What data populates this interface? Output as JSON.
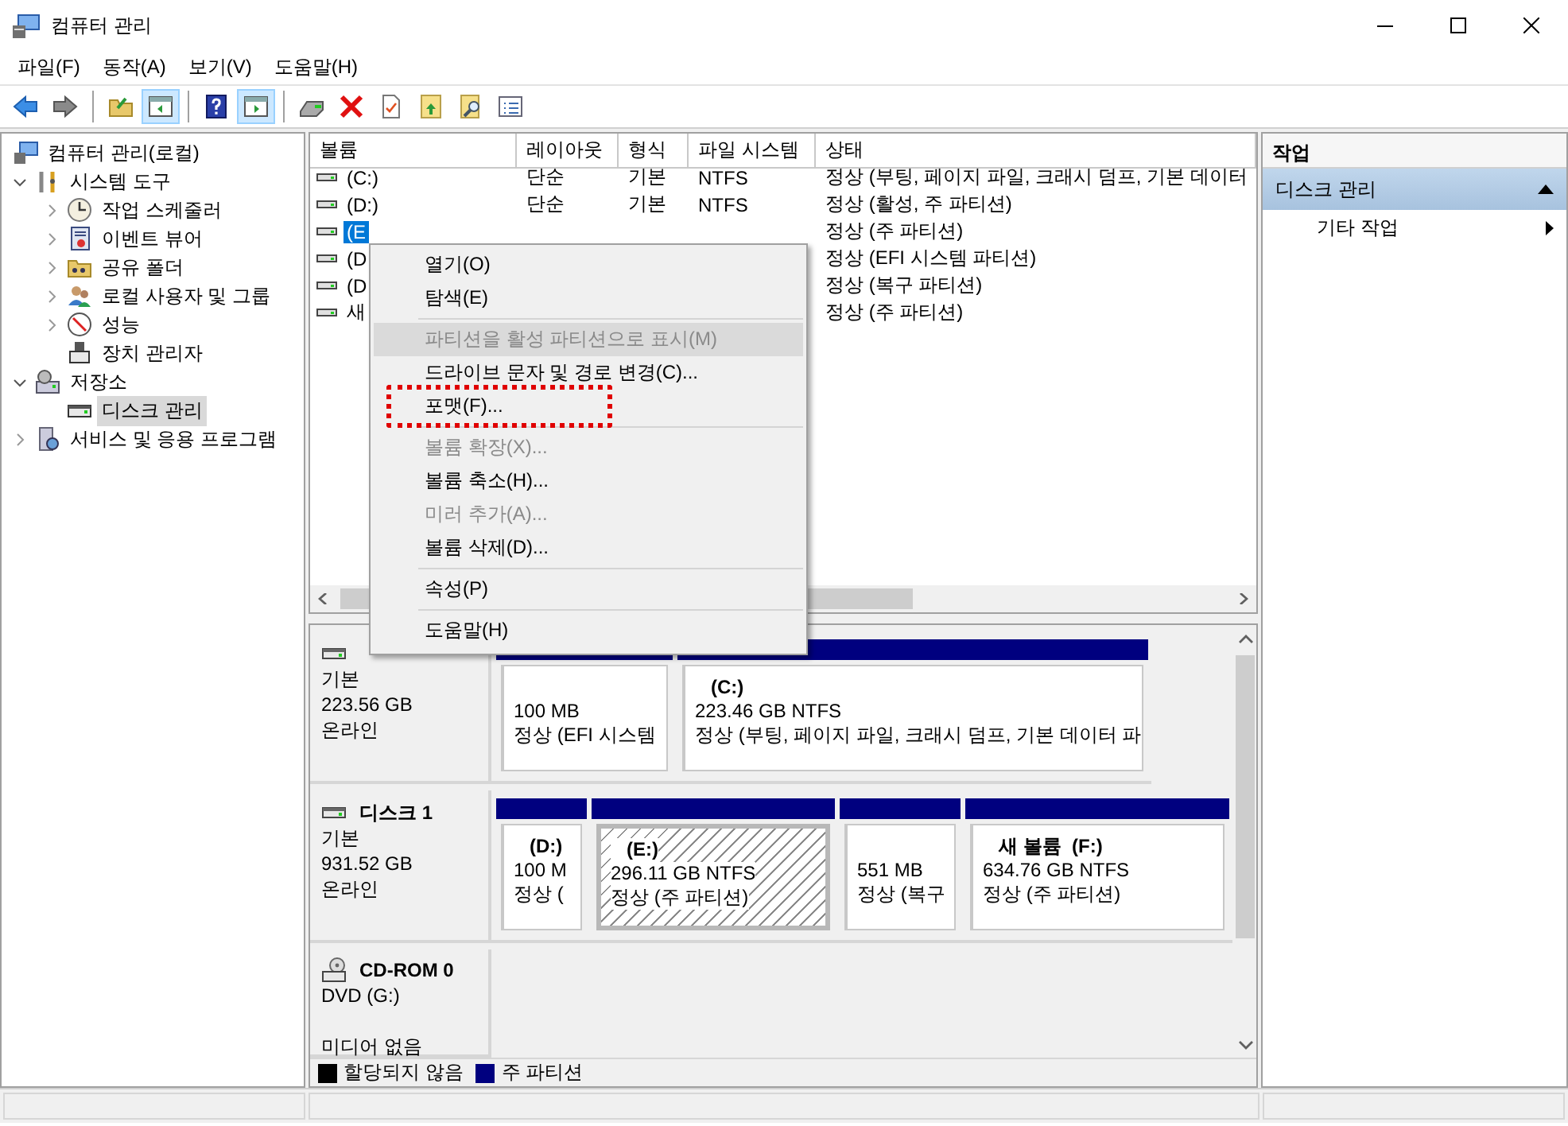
{
  "window": {
    "title": "컴퓨터 관리"
  },
  "menu_bar": [
    "파일(F)",
    "동작(A)",
    "보기(V)",
    "도움말(H)"
  ],
  "toolbar": [
    {
      "kind": "button",
      "pressed": false
    },
    {
      "kind": "button",
      "pressed": false
    },
    {
      "kind": "separator"
    },
    {
      "kind": "button",
      "pressed": false
    },
    {
      "kind": "button",
      "pressed": true
    },
    {
      "kind": "separator"
    },
    {
      "kind": "button",
      "pressed": false
    },
    {
      "kind": "button",
      "pressed": true
    },
    {
      "kind": "separator"
    },
    {
      "kind": "button",
      "pressed": false
    },
    {
      "kind": "button",
      "pressed": false
    },
    {
      "kind": "button",
      "pressed": false
    },
    {
      "kind": "button",
      "pressed": false
    },
    {
      "kind": "button",
      "pressed": false
    },
    {
      "kind": "button",
      "pressed": false
    }
  ],
  "tree": [
    {
      "label": "컴퓨터 관리(로컬)",
      "selected": false,
      "children": [
        {
          "label": "시스템 도구",
          "expanded": true,
          "selected": false,
          "children": [
            {
              "label": "작업 스케줄러",
              "expanded": false,
              "selected": false
            },
            {
              "label": "이벤트 뷰어",
              "expanded": false,
              "selected": false
            },
            {
              "label": "공유 폴더",
              "expanded": false,
              "selected": false
            },
            {
              "label": "로컬 사용자 및 그룹",
              "expanded": false,
              "selected": false
            },
            {
              "label": "성능",
              "expanded": false,
              "selected": false
            },
            {
              "label": "장치 관리자",
              "selected": false
            }
          ]
        },
        {
          "label": "저장소",
          "expanded": true,
          "selected": false,
          "children": [
            {
              "label": "디스크 관리",
              "selected": true
            }
          ]
        },
        {
          "label": "서비스 및 응용 프로그램",
          "expanded": false,
          "selected": false
        }
      ]
    }
  ],
  "table": {
    "columns": [
      "볼륨",
      "레이아웃",
      "형식",
      "파일 시스템",
      "상태"
    ],
    "rows": [
      {
        "volume": "(C:)",
        "layout": "단순",
        "type": "기본",
        "file_system": "NTFS",
        "status": "정상 (부팅, 페이지 파일, 크래시 덤프, 기본 데이터",
        "selected": false
      },
      {
        "volume": "(D:)",
        "layout": "단순",
        "type": "기본",
        "file_system": "NTFS",
        "status": "정상 (활성, 주 파티션)",
        "selected": false
      },
      {
        "volume": "(E",
        "status": "정상 (주 파티션)",
        "selected": true
      },
      {
        "volume": "(D",
        "status": "정상 (EFI 시스템 파티션)",
        "selected": false
      },
      {
        "volume": "(D",
        "status": "정상 (복구 파티션)",
        "selected": false
      },
      {
        "volume": "새",
        "status": "정상 (주 파티션)",
        "selected": false
      }
    ]
  },
  "context_menu": [
    {
      "kind": "item",
      "label": "열기(O)",
      "disabled": false,
      "hovered": false,
      "marked": false
    },
    {
      "kind": "item",
      "label": "탐색(E)",
      "disabled": false,
      "hovered": false,
      "marked": false
    },
    {
      "kind": "separator"
    },
    {
      "kind": "item",
      "label": "파티션을 활성 파티션으로 표시(M)",
      "disabled": true,
      "hovered": true,
      "marked": false
    },
    {
      "kind": "item",
      "label": "드라이브 문자 및 경로 변경(C)...",
      "disabled": false,
      "hovered": false,
      "marked": false
    },
    {
      "kind": "item",
      "label": "포맷(F)...",
      "disabled": false,
      "hovered": false,
      "marked": true
    },
    {
      "kind": "separator"
    },
    {
      "kind": "item",
      "label": "볼륨 확장(X)...",
      "disabled": true,
      "hovered": false,
      "marked": false
    },
    {
      "kind": "item",
      "label": "볼륨 축소(H)...",
      "disabled": false,
      "hovered": false,
      "marked": false
    },
    {
      "kind": "item",
      "label": "미러 추가(A)...",
      "disabled": true,
      "hovered": false,
      "marked": false
    },
    {
      "kind": "item",
      "label": "볼륨 삭제(D)...",
      "disabled": false,
      "hovered": false,
      "marked": false
    },
    {
      "kind": "separator"
    },
    {
      "kind": "item",
      "label": "속성(P)",
      "disabled": false,
      "hovered": false,
      "marked": false
    },
    {
      "kind": "separator"
    },
    {
      "kind": "item",
      "label": "도움말(H)",
      "disabled": false,
      "hovered": false,
      "marked": false
    }
  ],
  "disks": [
    {
      "kind": "disk",
      "type": "기본",
      "size": "223.56 GB",
      "status": "온라인",
      "partitions": [
        {
          "size": "100 MB",
          "status": "정상 (EFI 시스템",
          "selected": false
        },
        {
          "name": "(C:)",
          "size": "223.46 GB NTFS",
          "status": "정상 (부팅, 페이지 파일, 크래시 덤프, 기본 데이터 파",
          "selected": false
        }
      ]
    },
    {
      "kind": "disk",
      "title": "디스크 1",
      "type": "기본",
      "size": "931.52 GB",
      "status": "온라인",
      "partitions": [
        {
          "name": "(D:)",
          "size": "100 M",
          "status": "정상 (",
          "selected": false
        },
        {
          "name": "(E:)",
          "size": "296.11 GB NTFS",
          "status": "정상 (주 파티션)",
          "selected": true
        },
        {
          "size": "551 MB",
          "status": "정상 (복구",
          "selected": false
        },
        {
          "name": "새 볼륨  (F:)",
          "size": "634.76 GB NTFS",
          "status": "정상 (주 파티션)",
          "selected": false
        }
      ]
    },
    {
      "kind": "cdrom",
      "title": "CD-ROM 0",
      "type": "DVD (G:)",
      "status": "미디어 없음"
    }
  ],
  "legend": [
    {
      "label": "할당되지 않음",
      "color": "#000000"
    },
    {
      "label": "주 파티션",
      "color": "#00007f"
    }
  ],
  "actions": {
    "title": "작업",
    "sections": [
      {
        "label": "디스크 관리",
        "expanded": true,
        "items": [
          "기타 작업"
        ]
      }
    ]
  }
}
